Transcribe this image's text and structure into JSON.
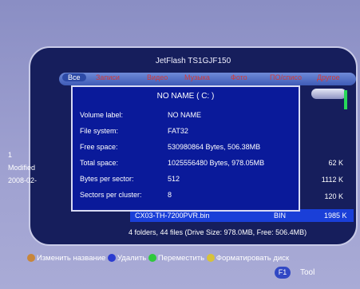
{
  "device_title": "JetFlash TS1GJF150",
  "tabs": [
    "Все",
    "Записи",
    "Видео",
    "Музыка",
    "Фото",
    "ПО/списо",
    "Другое"
  ],
  "left_panel": {
    "index": "1",
    "modified_label": "Modified",
    "date_partial": "2008-02-"
  },
  "file_sizes": [
    "62 K",
    "1112 K",
    "120 K"
  ],
  "selected_file": {
    "name": "CX03-TH-7200PVR.bin",
    "type": "BIN",
    "size": "1985 K"
  },
  "summary": "4 folders, 44 files (Drive Size: 978.0MB, Free: 506.4MB)",
  "dialog": {
    "title": "NO NAME    ( C: )",
    "rows": [
      {
        "label": "Volume label:",
        "value": "NO NAME"
      },
      {
        "label": "File system:",
        "value": "FAT32"
      },
      {
        "label": "Free space:",
        "value": "530980864 Bytes, 506.38MB"
      },
      {
        "label": "Total space:",
        "value": "1025556480 Bytes, 978.05MB"
      },
      {
        "label": "Bytes per sector:",
        "value": "512"
      },
      {
        "label": "Sectors per cluster:",
        "value": "8"
      }
    ]
  },
  "legend": [
    {
      "color": "#c8863a",
      "label": "Изменить название"
    },
    {
      "color": "#2b3bd0",
      "label": "Удалить"
    },
    {
      "color": "#2fc93c",
      "label": "Переместить"
    },
    {
      "color": "#d7c23a",
      "label": "Форматировать диск"
    }
  ],
  "f1_key": "F1",
  "tool_label": "Tool"
}
